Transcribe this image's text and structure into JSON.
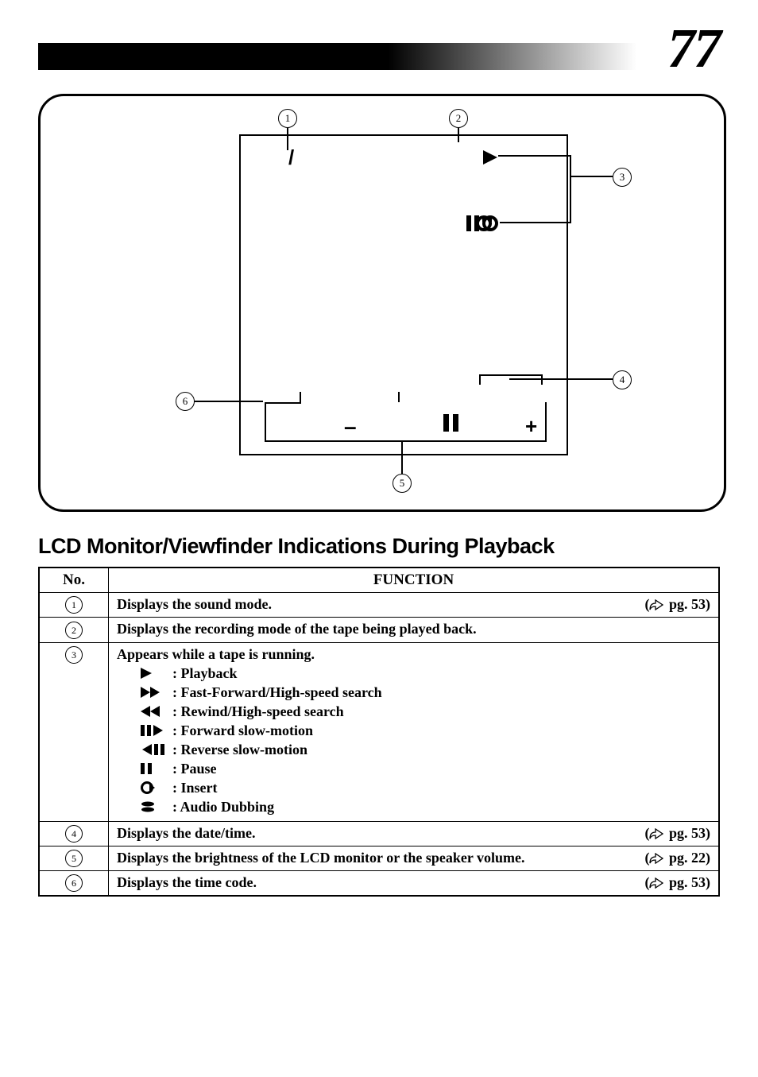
{
  "page_number": "77",
  "section_title": "LCD Monitor/Viewfinder Indications During Playback",
  "table_header": {
    "no": "No.",
    "function": "FUNCTION"
  },
  "diagram": {
    "callouts": [
      "1",
      "2",
      "3",
      "4",
      "5",
      "6"
    ],
    "sound_mode_symbol": "/",
    "minus": "–",
    "plus": "+"
  },
  "rows": {
    "r1": {
      "no": "1",
      "text": "Displays the sound mode.",
      "ref": "pg. 53"
    },
    "r2": {
      "no": "2",
      "text": "Displays the recording mode of the tape being played back."
    },
    "r3": {
      "no": "3",
      "intro": "Appears while a tape is running.",
      "modes": [
        {
          "icon": "play",
          "label": ": Playback"
        },
        {
          "icon": "ffwd",
          "label": ": Fast-Forward/High-speed search"
        },
        {
          "icon": "rwd",
          "label": ": Rewind/High-speed search"
        },
        {
          "icon": "fwd-slow",
          "label": ": Forward slow-motion"
        },
        {
          "icon": "rev-slow",
          "label": ": Reverse slow-motion"
        },
        {
          "icon": "pause",
          "label": ": Pause"
        },
        {
          "icon": "insert",
          "label": ": Insert"
        },
        {
          "icon": "audio-dub",
          "label": ": Audio Dubbing"
        }
      ]
    },
    "r4": {
      "no": "4",
      "text": "Displays the date/time.",
      "ref": "pg. 53"
    },
    "r5": {
      "no": "5",
      "text": "Displays the brightness of the LCD monitor or the speaker volume.",
      "ref": "pg. 22"
    },
    "r6": {
      "no": "6",
      "text": "Displays the time code.",
      "ref": "pg. 53"
    }
  }
}
